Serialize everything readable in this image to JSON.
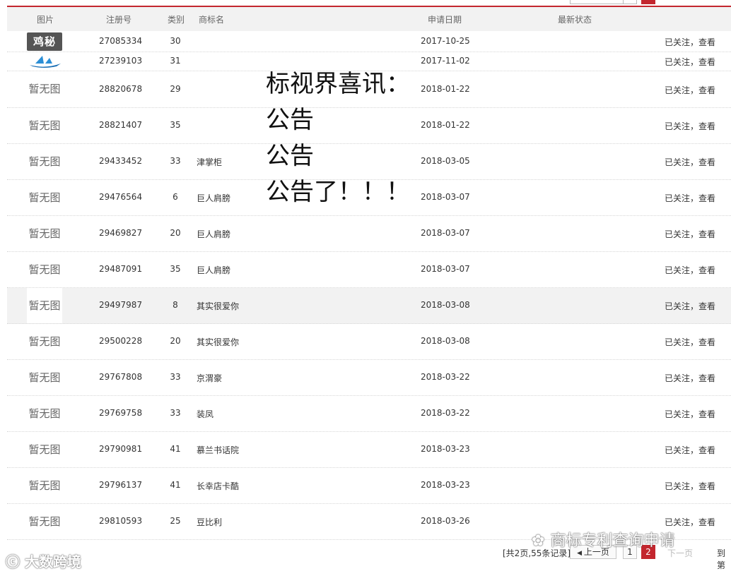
{
  "header": {
    "col_image": "图片",
    "col_reg": "注册号",
    "col_class": "类别",
    "col_name": "商标名",
    "col_date": "申请日期",
    "col_status": "最新状态"
  },
  "rows": [
    {
      "img_text": "",
      "img_type": "logo-jimi",
      "reg": "27085334",
      "cls": "30",
      "name": "",
      "date": "2017-10-25",
      "action": "已关注，查看"
    },
    {
      "img_text": "",
      "img_type": "logo-boat",
      "reg": "27239103",
      "cls": "31",
      "name": "",
      "date": "2017-11-02",
      "action": "已关注，查看"
    },
    {
      "img_text": "暂无图",
      "reg": "28820678",
      "cls": "29",
      "name": "",
      "date": "2018-01-22",
      "action": "已关注，查看"
    },
    {
      "img_text": "暂无图",
      "reg": "28821407",
      "cls": "35",
      "name": "",
      "date": "2018-01-22",
      "action": "已关注，查看"
    },
    {
      "img_text": "暂无图",
      "reg": "29433452",
      "cls": "33",
      "name": "津掌柜",
      "date": "2018-03-05",
      "action": "已关注，查看"
    },
    {
      "img_text": "暂无图",
      "reg": "29476564",
      "cls": "6",
      "name": "巨人肩膀",
      "date": "2018-03-07",
      "action": "已关注，查看"
    },
    {
      "img_text": "暂无图",
      "reg": "29469827",
      "cls": "20",
      "name": "巨人肩膀",
      "date": "2018-03-07",
      "action": "已关注，查看"
    },
    {
      "img_text": "暂无图",
      "reg": "29487091",
      "cls": "35",
      "name": "巨人肩膀",
      "date": "2018-03-07",
      "action": "已关注，查看"
    },
    {
      "img_text": "暂无图",
      "reg": "29497987",
      "cls": "8",
      "name": "其实很爱你",
      "date": "2018-03-08",
      "action": "已关注，查看",
      "highlight": true
    },
    {
      "img_text": "暂无图",
      "reg": "29500228",
      "cls": "20",
      "name": "其实很爱你",
      "date": "2018-03-08",
      "action": "已关注，查看"
    },
    {
      "img_text": "暂无图",
      "reg": "29767808",
      "cls": "33",
      "name": "京渭豪",
      "date": "2018-03-22",
      "action": "已关注，查看"
    },
    {
      "img_text": "暂无图",
      "reg": "29769758",
      "cls": "33",
      "name": "装凤",
      "date": "2018-03-22",
      "action": "已关注，查看"
    },
    {
      "img_text": "暂无图",
      "reg": "29790981",
      "cls": "41",
      "name": "慕兰书话院",
      "date": "2018-03-23",
      "action": "已关注，查看"
    },
    {
      "img_text": "暂无图",
      "reg": "29796137",
      "cls": "41",
      "name": "长幸店卡酷",
      "date": "2018-03-23",
      "action": "已关注，查看"
    },
    {
      "img_text": "暂无图",
      "reg": "29810593",
      "cls": "25",
      "name": "豆比利",
      "date": "2018-03-26",
      "action": "已关注，查看"
    }
  ],
  "logo_jimi_text": "鸡秘",
  "notice": {
    "line1": "标视界喜讯：",
    "line2": "公告",
    "line3": "公告",
    "line4": "公告了！！！"
  },
  "pager": {
    "total": "[共2页,55条记录]",
    "prev": "上一页",
    "page1": "1",
    "page2": "2",
    "next": "下一页",
    "goto": "到第"
  },
  "watermarks": {
    "left": "大数跨境",
    "right": "商标专利查询申请"
  },
  "colors": {
    "accent": "#c3262e",
    "header_bg": "#f2f2f2",
    "text": "#333333"
  }
}
